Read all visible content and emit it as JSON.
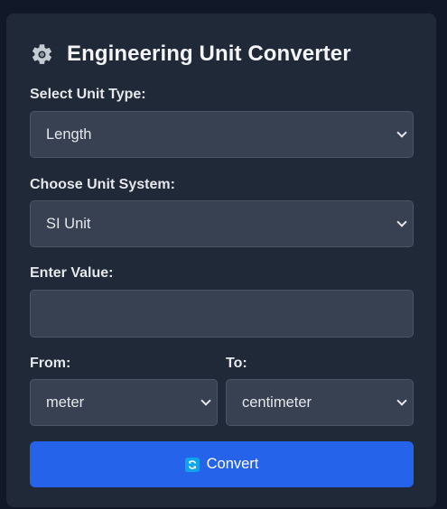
{
  "app": {
    "title": "Engineering Unit Converter"
  },
  "form": {
    "unit_type": {
      "label": "Select Unit Type:",
      "value": "Length"
    },
    "unit_system": {
      "label": "Choose Unit System:",
      "value": "SI Unit"
    },
    "value_field": {
      "label": "Enter Value:",
      "value": "",
      "placeholder": ""
    },
    "from": {
      "label": "From:",
      "value": "meter"
    },
    "to": {
      "label": "To:",
      "value": "centimeter"
    },
    "convert_label": "Convert"
  },
  "colors": {
    "page_bg": "#111827",
    "card_bg": "#1f2937",
    "field_bg": "#374151",
    "accent": "#2563eb"
  },
  "icons": [
    "gear-icon",
    "refresh-icon",
    "chevron-down-icon"
  ]
}
